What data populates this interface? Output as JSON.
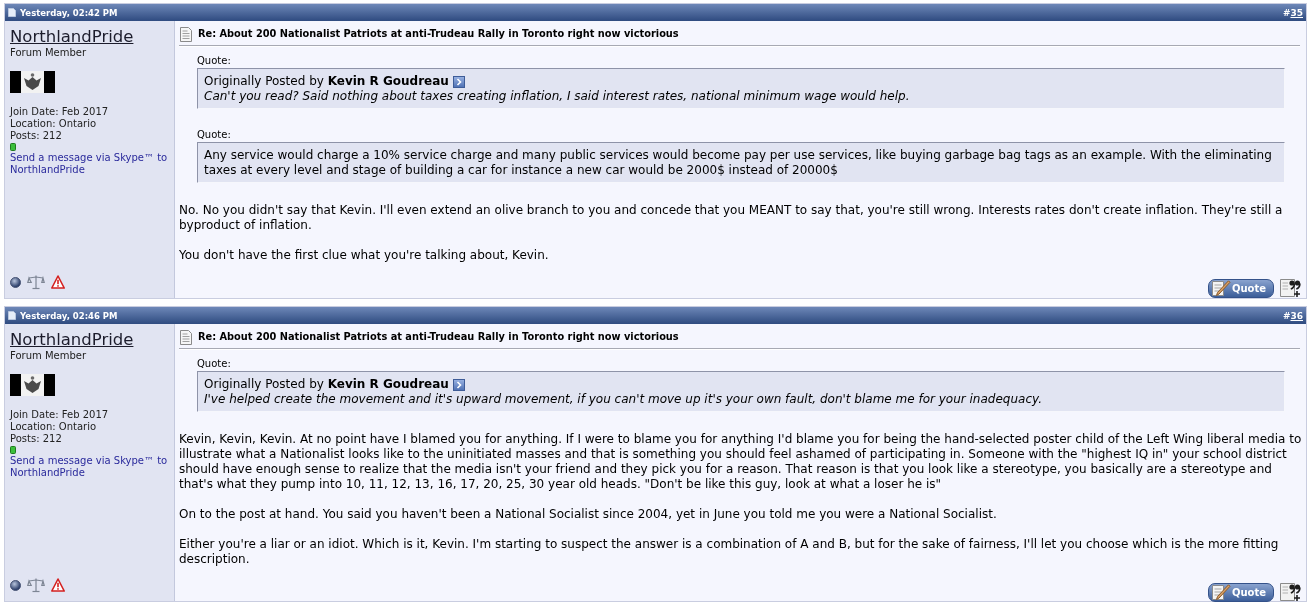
{
  "posts": [
    {
      "date": "Yesterday, 02:42 PM",
      "number_prefix": "#",
      "number": "35",
      "user": {
        "name": "NorthlandPride",
        "title": "Forum Member",
        "details": [
          "Join Date: Feb 2017",
          "Location: Ontario",
          "Posts: 212"
        ],
        "skype_link": "Send a message via Skype™ to NorthlandPride"
      },
      "title": "Re: About 200 Nationalist Patriots at anti-Trudeau Rally in Toronto right now victorious",
      "blocks": [
        {
          "kind": "attributed_quote",
          "label": "Quote:",
          "attribution": "Originally Posted by **Kevin R Goudreau**",
          "text": "Can't you read? Said nothing about taxes creating inflation, I said interest rates, national minimum wage would help."
        },
        {
          "kind": "quote",
          "label": "Quote:",
          "text": "Any service would charge a 10% service charge and many public services would become pay per use services, like buying garbage bag tags as an example. With the eliminating taxes at every level and stage of building a car for instance a new car would be 2000$ instead of 20000$"
        },
        {
          "kind": "paragraph",
          "text": "No. No you didn't say that Kevin. I'll even extend an olive branch to you and concede that you MEANT to say that, you're still wrong. Interests rates don't create inflation. They're still a byproduct of inflation."
        },
        {
          "kind": "paragraph",
          "text": "You don't have the first clue what you're talking about, Kevin."
        }
      ],
      "quote_button": "Quote"
    },
    {
      "date": "Yesterday, 02:46 PM",
      "number_prefix": "#",
      "number": "36",
      "user": {
        "name": "NorthlandPride",
        "title": "Forum Member",
        "details": [
          "Join Date: Feb 2017",
          "Location: Ontario",
          "Posts: 212"
        ],
        "skype_link": "Send a message via Skype™ to NorthlandPride"
      },
      "title": "Re: About 200 Nationalist Patriots at anti-Trudeau Rally in Toronto right now victorious",
      "blocks": [
        {
          "kind": "attributed_quote",
          "label": "Quote:",
          "attribution": "Originally Posted by **Kevin R Goudreau**",
          "text": "I've helped create the movement and it's upward movement, if you can't move up it's your own fault, don't blame me for your inadequacy."
        },
        {
          "kind": "paragraph",
          "text": "Kevin, Kevin, Kevin. At no point have I blamed you for anything. If I were to blame you for anything I'd blame you for being the hand-selected poster child of the Left Wing liberal media to illustrate what a Nationalist looks like to the uninitiated masses and that is something you should feel ashamed of participating in. Someone with the \"highest IQ in\" your school district should have enough sense to realize that the media isn't your friend and they pick you for a reason. That reason is that you look like a stereotype, you basically are a stereotype and that's what they pump into 10, 11, 12, 13, 16, 17, 20, 25, 30 year old heads. \"Don't be like this guy, look at what a loser he is\""
        },
        {
          "kind": "paragraph",
          "text": "On to the post at hand. You said you haven't been a National Socialist since 2004, yet in June you told me you were a National Socialist."
        },
        {
          "kind": "paragraph",
          "text": "Either you're a liar or an idiot. Which is it, Kevin. I'm starting to suspect the answer is a combination of A and B, but for the sake of fairness, I'll let you choose which is the more fitting description."
        }
      ],
      "quote_button": "Quote"
    }
  ]
}
